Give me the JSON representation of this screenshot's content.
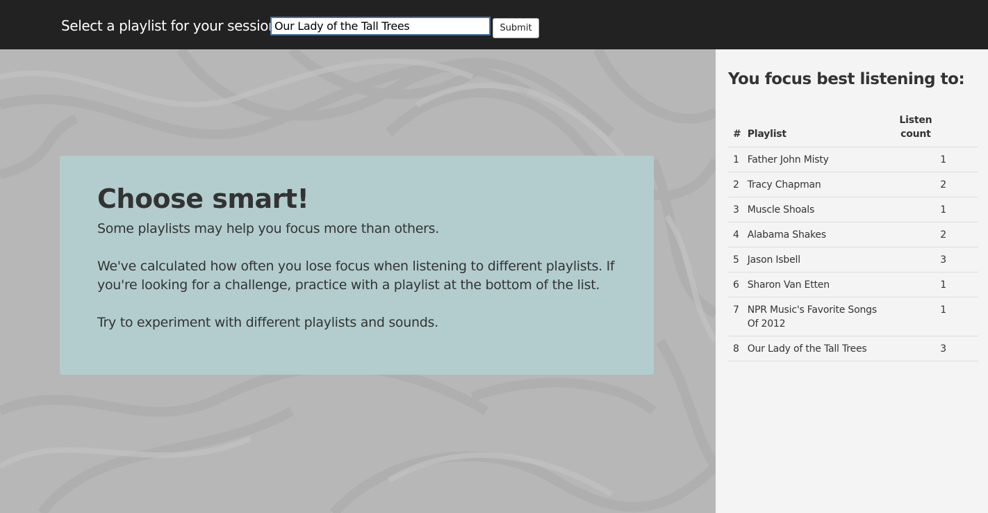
{
  "header": {
    "prompt_label": "Select a playlist for your session:",
    "input_value": "Our Lady of the Tall Trees",
    "submit_label": "Submit"
  },
  "card": {
    "title": "Choose smart!",
    "paragraphs": [
      "Some playlists may help you focus more than others.",
      "We've calculated how often you lose focus when listening to different playlists. If you're looking for a challenge, practice with a playlist at the bottom of the list.",
      "Try to experiment with different playlists and sounds."
    ]
  },
  "sidebar": {
    "title": "You focus best listening to:",
    "columns": [
      "#",
      "Playlist",
      "Listen count"
    ],
    "rows": [
      {
        "rank": "1",
        "playlist": "Father John Misty",
        "count": "1"
      },
      {
        "rank": "2",
        "playlist": "Tracy Chapman",
        "count": "2"
      },
      {
        "rank": "3",
        "playlist": "Muscle Shoals",
        "count": "1"
      },
      {
        "rank": "4",
        "playlist": "Alabama Shakes",
        "count": "2"
      },
      {
        "rank": "5",
        "playlist": "Jason Isbell",
        "count": "3"
      },
      {
        "rank": "6",
        "playlist": "Sharon Van Etten",
        "count": "1"
      },
      {
        "rank": "7",
        "playlist": "NPR Music's Favorite Songs Of 2012",
        "count": "1"
      },
      {
        "rank": "8",
        "playlist": "Our Lady of the Tall Trees",
        "count": "3"
      }
    ]
  },
  "colors": {
    "topbar": "#222222",
    "background": "#b7b7b7",
    "card": "#b3cdce",
    "sidebar": "#f4f4f4",
    "text": "#333333"
  }
}
